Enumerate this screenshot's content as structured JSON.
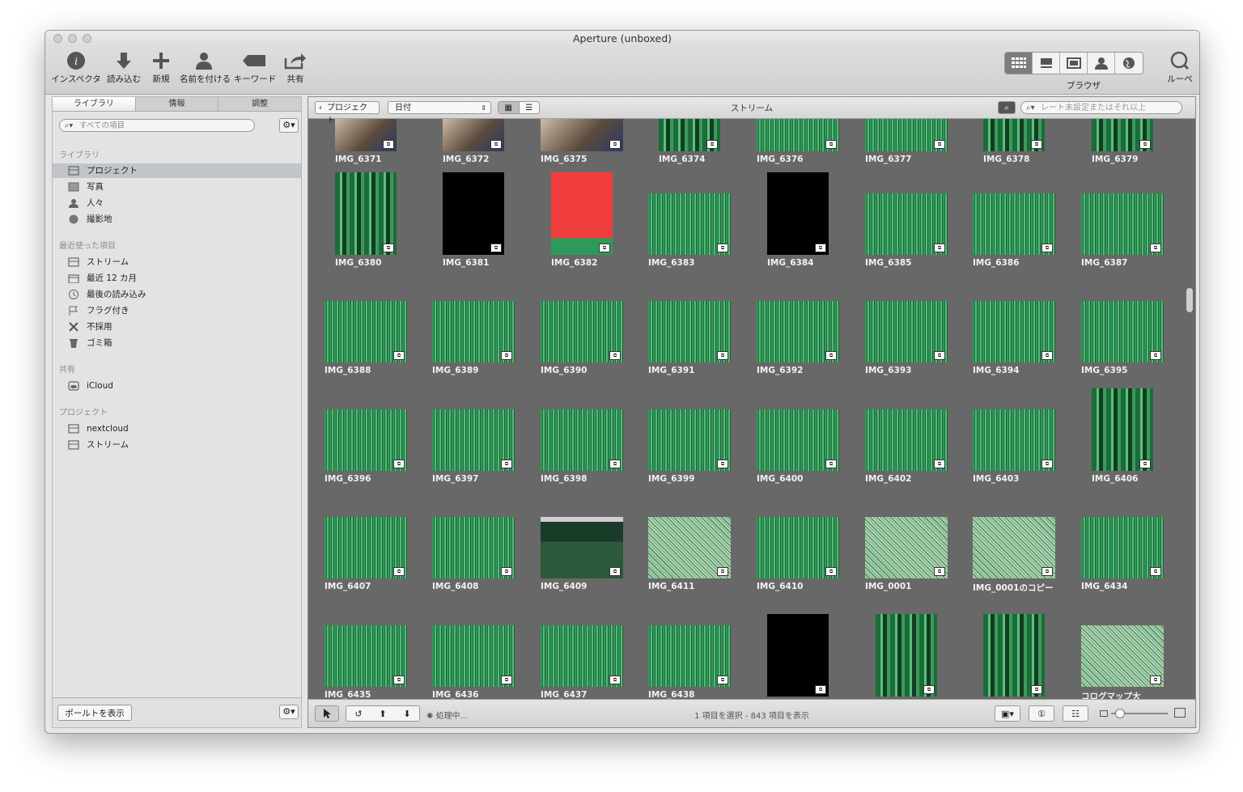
{
  "window": {
    "title": "Aperture (unboxed)"
  },
  "toolbar": {
    "inspector": "インスペクタ",
    "import": "読み込む",
    "new": "新規",
    "name_faces": "名前を付ける",
    "keyword": "キーワード",
    "share": "共有",
    "browser": "ブラウザ",
    "loupe": "ルーペ"
  },
  "sidebar": {
    "tabs": [
      "ライブラリ",
      "情報",
      "調整"
    ],
    "search_placeholder": "すべての項目",
    "library_header": "ライブラリ",
    "library_items": [
      "プロジェクト",
      "写真",
      "人々",
      "撮影地"
    ],
    "recent_header": "最近使った項目",
    "recent_items": [
      "ストリーム",
      "最近 12 カ月",
      "最後の読み込み",
      "フラグ付き",
      "不採用",
      "ゴミ箱"
    ],
    "shared_header": "共有",
    "shared_items": [
      "iCloud"
    ],
    "projects_header": "プロジェクト",
    "project_items": [
      "nextcloud",
      "ストリーム"
    ],
    "portal_button": "ポールトを表示"
  },
  "browser": {
    "back_button": "プロジェクト",
    "sort_select": "日付",
    "title": "ストリーム",
    "search_placeholder": "レート未設定またはそれ以上",
    "status_processing": "処理中...",
    "status_count": "1 項目を選択 - 843 項目を表示"
  },
  "photos": [
    "IMG_6371",
    "IMG_6372",
    "IMG_6375",
    "IMG_6374",
    "IMG_6376",
    "IMG_6377",
    "IMG_6378",
    "IMG_6379",
    "IMG_6380",
    "IMG_6381",
    "IMG_6382",
    "IMG_6383",
    "IMG_6384",
    "IMG_6385",
    "IMG_6386",
    "IMG_6387",
    "IMG_6388",
    "IMG_6389",
    "IMG_6390",
    "IMG_6391",
    "IMG_6392",
    "IMG_6393",
    "IMG_6394",
    "IMG_6395",
    "IMG_6396",
    "IMG_6397",
    "IMG_6398",
    "IMG_6399",
    "IMG_6400",
    "IMG_6402",
    "IMG_6403",
    "IMG_6406",
    "IMG_6407",
    "IMG_6408",
    "IMG_6409",
    "IMG_6411",
    "IMG_6410",
    "IMG_0001",
    "IMG_0001のコピー",
    "IMG_6434",
    "IMG_6435",
    "IMG_6436",
    "IMG_6437",
    "IMG_6438",
    "",
    "",
    "",
    "コログマップ大"
  ],
  "colors": {
    "browser_bg": "#686868",
    "selection": "#c1c4c9"
  }
}
